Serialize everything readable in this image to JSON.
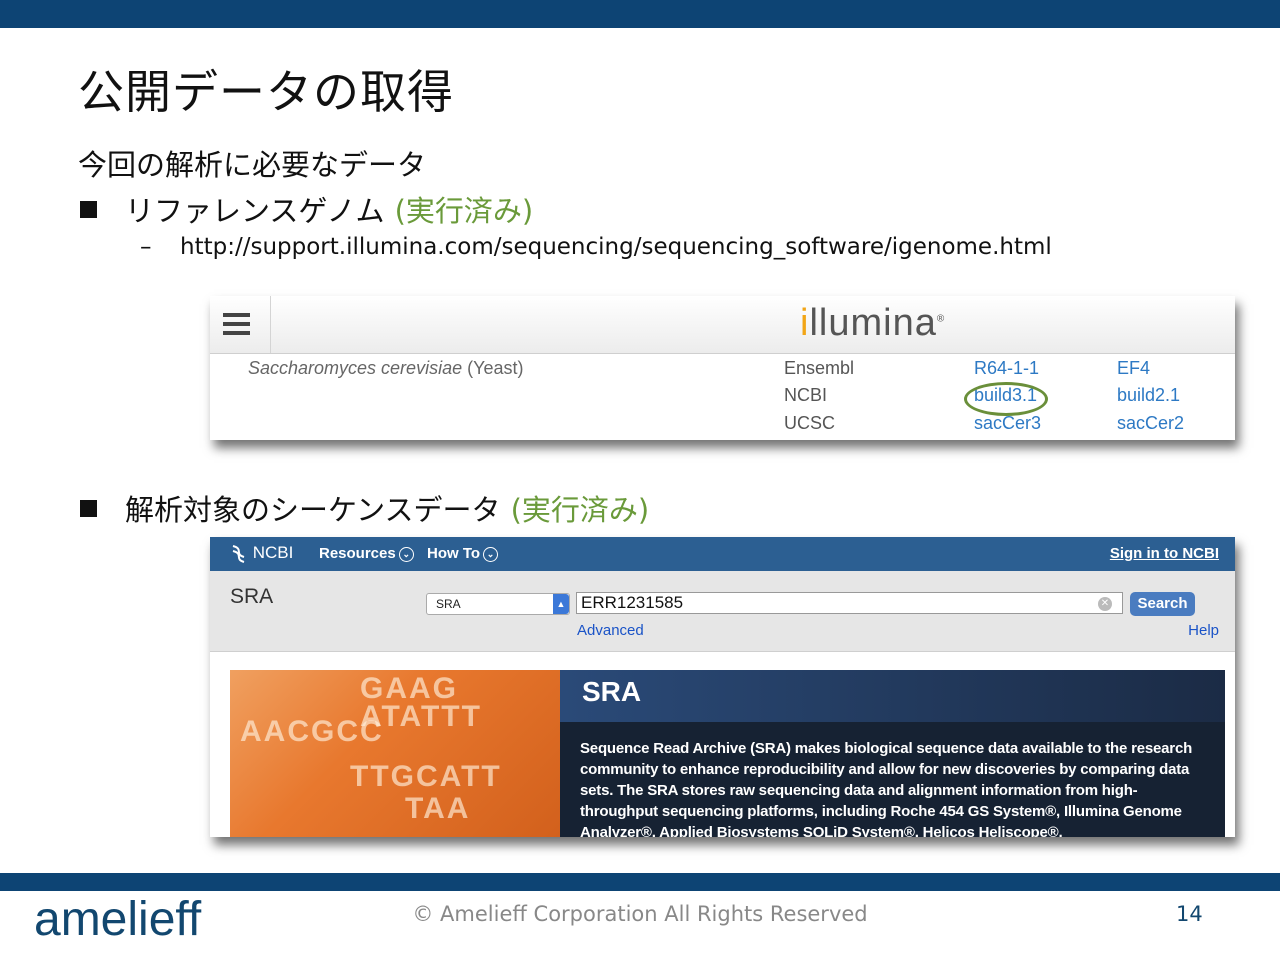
{
  "slide": {
    "title": "公開データの取得",
    "subtitle": "今回の解析に必要なデータ",
    "bullets": [
      {
        "text": "リファレンスゲノム",
        "status": "(実行済み)"
      },
      {
        "text": "解析対象のシーケンスデータ",
        "status": "(実行済み)"
      }
    ],
    "url": "http://support.illumina.com/sequencing/sequencing_software/igenome.html",
    "url_dash": "–"
  },
  "illumina": {
    "logo_i": "i",
    "logo_rest": "llumina",
    "logo_reg": "®",
    "menu_icon": "hamburger-icon",
    "species": "Saccharomyces cerevisiae",
    "species_common": "(Yeast)",
    "rows": [
      {
        "source": "Ensembl",
        "build": "R64-1-1",
        "alt": "EF4"
      },
      {
        "source": "NCBI",
        "build": "build3.1",
        "alt": "build2.1"
      },
      {
        "source": "UCSC",
        "build": "sacCer3",
        "alt": "sacCer2"
      }
    ],
    "highlight_color": "#6a8f3a"
  },
  "ncbi": {
    "logo": "NCBI",
    "logo_icon": "ncbi-helix-icon",
    "nav": [
      "Resources",
      "How To"
    ],
    "sign_in": "Sign in to NCBI",
    "db_title": "SRA",
    "db_select": "SRA",
    "search_term": "ERR1231585",
    "search_button": "Search",
    "advanced": "Advanced",
    "help": "Help",
    "banner_title": "SRA",
    "banner_dna": [
      "GAAG",
      "ATATTT",
      "AACGCC",
      "TTGCATT",
      "TAA"
    ],
    "banner_text": "Sequence Read Archive (SRA) makes biological sequence data available to the research community to enhance reproducibility and allow for new discoveries by comparing data sets. The SRA stores raw sequencing data and alignment information from high-throughput sequencing platforms, including Roche 454 GS System®, Illumina Genome Analyzer®, Applied Biosystems SOLiD System®, Helicos Heliscope®,"
  },
  "footer": {
    "logo": "amelieff",
    "copyright": "© Amelieff Corporation All Rights Reserved",
    "page": "14"
  },
  "colors": {
    "brand_bar": "#0d4474",
    "status_green": "#6a9a3a",
    "ncbi_blue": "#2c5f92"
  }
}
